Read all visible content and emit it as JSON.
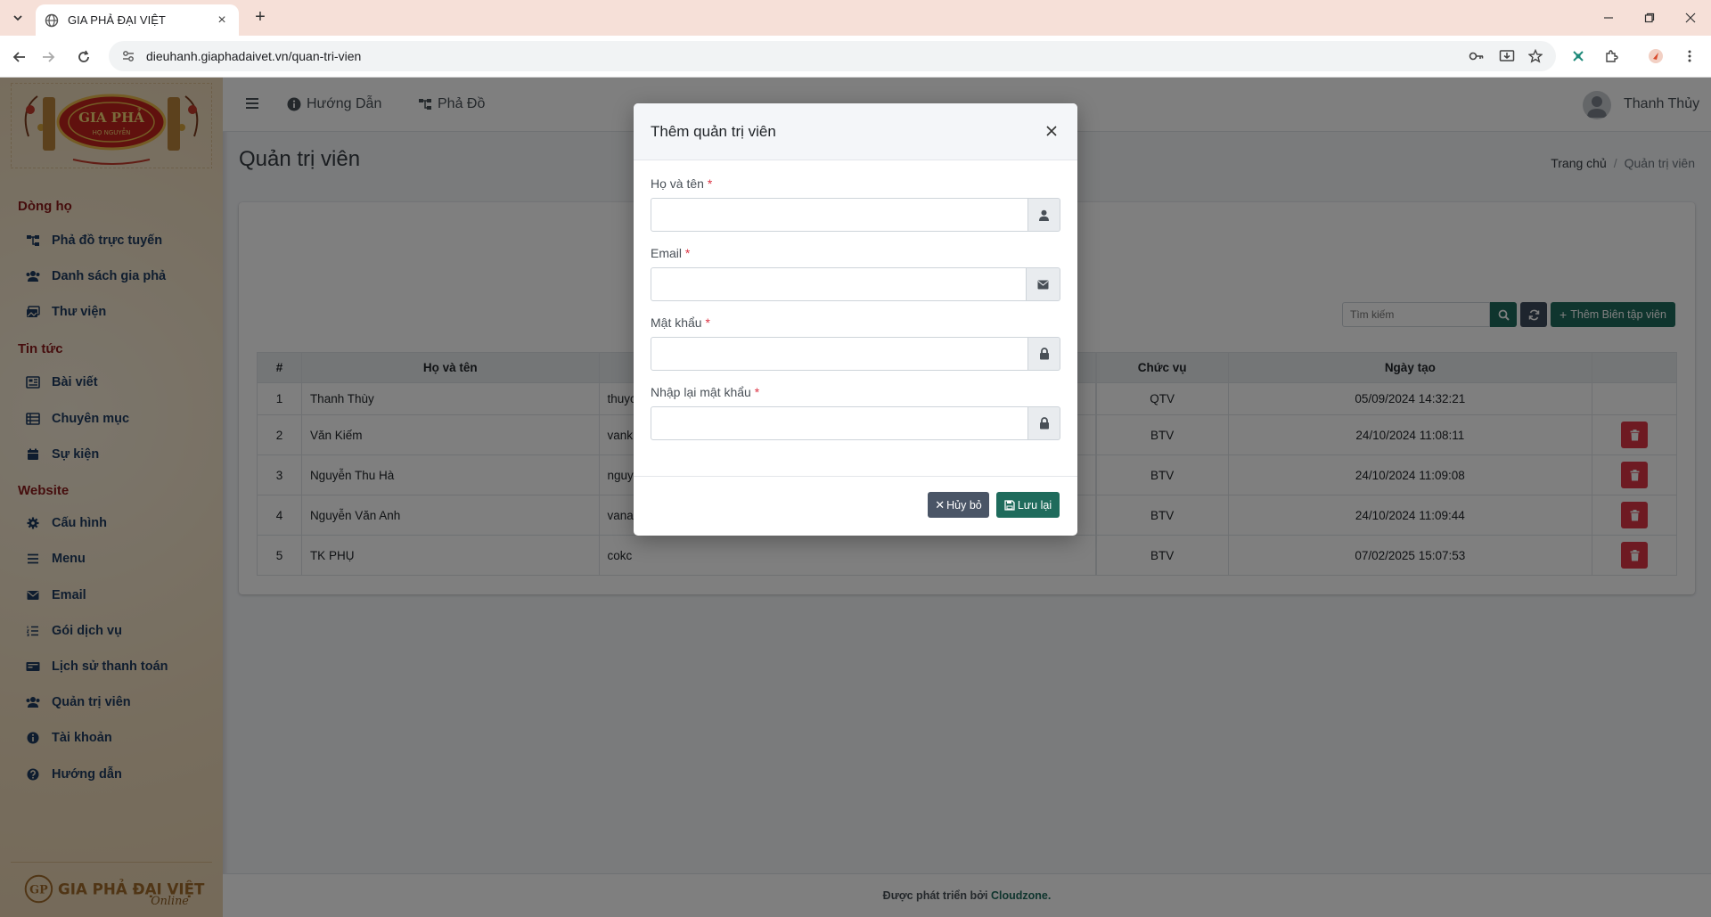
{
  "browser": {
    "tab_title": "GIA PHẢ ĐẠI VIỆT",
    "url": "dieuhanh.giaphadaivet.vn/quan-tri-vien"
  },
  "sidebar": {
    "sections": [
      {
        "title": "Dòng họ",
        "items": [
          {
            "label": "Phả đồ trực tuyến",
            "icon": "sitemap-icon"
          },
          {
            "label": "Danh sách gia phả",
            "icon": "users-icon"
          },
          {
            "label": "Thư viện",
            "icon": "images-icon"
          }
        ]
      },
      {
        "title": "Tin tức",
        "items": [
          {
            "label": "Bài viết",
            "icon": "newspaper-icon"
          },
          {
            "label": "Chuyên mục",
            "icon": "list-icon"
          },
          {
            "label": "Sự kiện",
            "icon": "calendar-icon"
          }
        ]
      },
      {
        "title": "Website",
        "items": [
          {
            "label": "Cấu hình",
            "icon": "gear-icon"
          },
          {
            "label": "Menu",
            "icon": "menu-icon"
          },
          {
            "label": "Email",
            "icon": "envelope-icon"
          },
          {
            "label": "Gói dịch vụ",
            "icon": "list-ol-icon"
          },
          {
            "label": "Lịch sử thanh toán",
            "icon": "credit-card-icon"
          },
          {
            "label": "Quản trị viên",
            "icon": "users-icon"
          },
          {
            "label": "Tài khoản",
            "icon": "info-icon"
          },
          {
            "label": "Hướng dẫn",
            "icon": "question-icon"
          }
        ]
      }
    ]
  },
  "topnav": {
    "guide": "Hướng Dẫn",
    "tree": "Phả Đồ",
    "user": "Thanh Thủy"
  },
  "page": {
    "title": "Quản trị viên",
    "breadcrumb_home": "Trang chủ",
    "breadcrumb_sep": "/",
    "breadcrumb_current": "Quản trị viên",
    "search_placeholder": "Tìm kiếm",
    "add_button": "Thêm Biên tập viên"
  },
  "table": {
    "headers": {
      "index": "#",
      "name": "Họ và tên",
      "role": "Chức vụ",
      "created": "Ngày tạo"
    },
    "rows": [
      {
        "index": "1",
        "name": "Thanh Thùy",
        "email": "thuyc",
        "role": "QTV",
        "created": "05/09/2024 14:32:21"
      },
      {
        "index": "2",
        "name": "Văn Kiếm",
        "email": "vank",
        "role": "BTV",
        "created": "24/10/2024 11:08:11"
      },
      {
        "index": "3",
        "name": "Nguyễn Thu Hà",
        "email": "nguy",
        "role": "BTV",
        "created": "24/10/2024 11:09:08"
      },
      {
        "index": "4",
        "name": "Nguyễn Văn Anh",
        "email": "vana",
        "role": "BTV",
        "created": "24/10/2024 11:09:44"
      },
      {
        "index": "5",
        "name": "TK PHỤ",
        "email": "cokc",
        "role": "BTV",
        "created": "07/02/2025 15:07:53"
      }
    ]
  },
  "footer": {
    "prefix": "Được phát triển bởi",
    "brand": "Cloudzone."
  },
  "modal": {
    "title": "Thêm quản trị viên",
    "fields": {
      "name": "Họ và tên",
      "email": "Email",
      "password": "Mật khẩu",
      "confirm": "Nhập lại mật khẩu"
    },
    "required_mark": "*",
    "cancel": "Hủy bỏ",
    "save": "Lưu lại"
  },
  "colors": {
    "primary": "#1f6b5c",
    "danger": "#dc3545",
    "sidebar_section": "#8b1a1a",
    "sidebar_item": "#1e3a5f"
  }
}
